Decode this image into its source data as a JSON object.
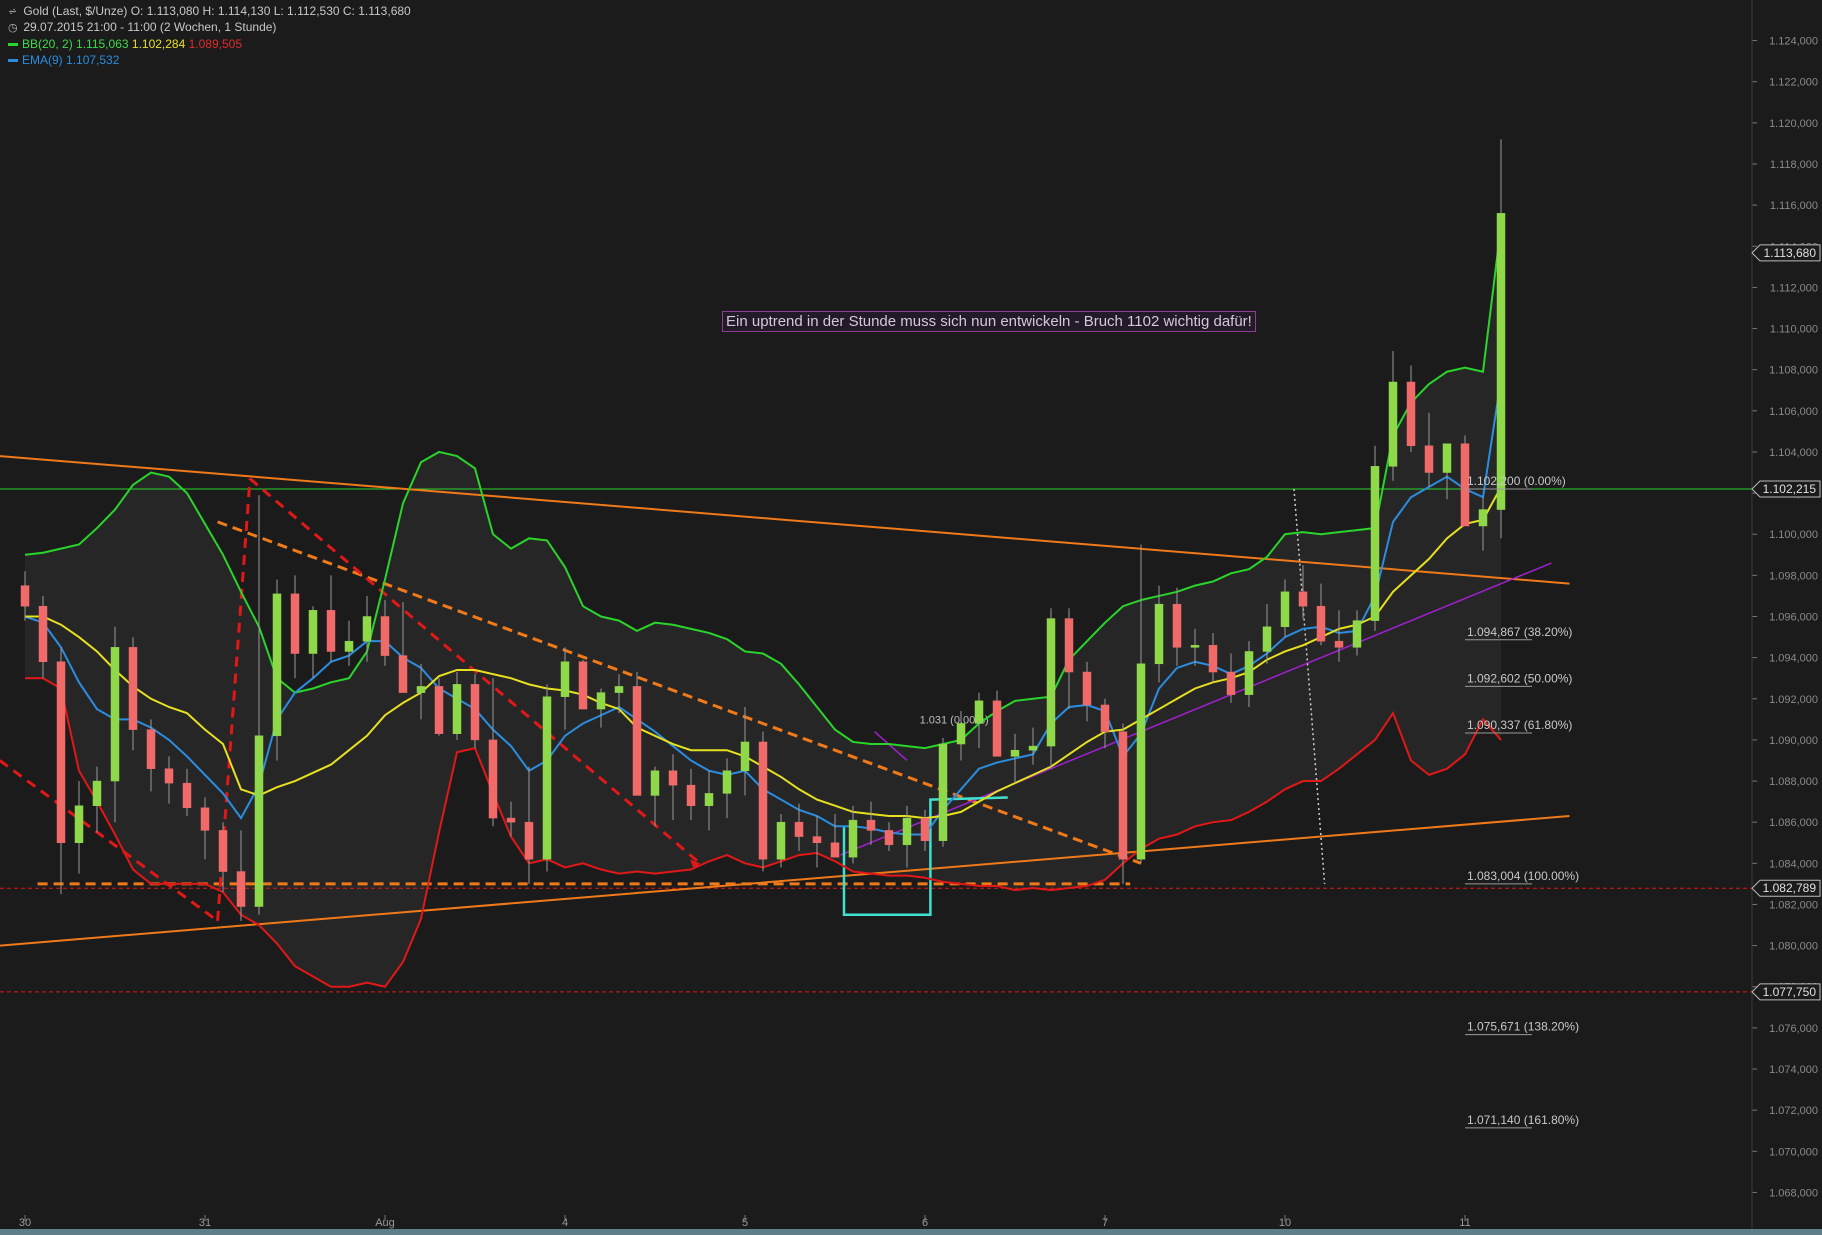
{
  "header": {
    "instrument_line": "Gold (Last, $/Unze)  O: 1.113,080  H: 1.114,130  L: 1.112,530  C: 1.113,680",
    "period_line": "29.07.2015 21:00 - 11:00 (2 Wochen, 1 Stunde)",
    "bb_label": "BB(20, 2)",
    "bb_upper": "1.115,063",
    "bb_mid": "1.102,284",
    "bb_lower": "1.089,505",
    "ema_label": "EMA(9)",
    "ema_value": "1.107,532"
  },
  "annotation": "Ein uptrend in der Stunde muss sich nun entwickeln - Bruch 1102 wichtig dafür!",
  "colors": {
    "background": "#1b1b1b",
    "bb_upper": "#2ad42a",
    "bb_lower": "#e01818",
    "bb_mid": "#e6e020",
    "ema": "#2b8de0",
    "up_candle": "#8fd84a",
    "down_candle": "#f06a6a",
    "trendline": "#f07a1a",
    "red_dashed": "#e01818",
    "cyan_shape": "#3fe0d0",
    "violet_line": "#a020d0",
    "resistance_line": "#2ad42a"
  },
  "chart_data": {
    "type": "candlestick",
    "ylim": [
      1067000,
      1125000
    ],
    "y_ticks": [
      "1.124,000",
      "1.122,000",
      "1.120,000",
      "1.118,000",
      "1.116,000",
      "1.114,000",
      "1.112,000",
      "1.110,000",
      "1.108,000",
      "1.106,000",
      "1.104,000",
      "1.102,000",
      "1.100,000",
      "1.098,000",
      "1.096,000",
      "1.094,000",
      "1.092,000",
      "1.090,000",
      "1.088,000",
      "1.086,000",
      "1.084,000",
      "1.082,000",
      "1.080,000",
      "1.078,000",
      "1.076,000",
      "1.074,000",
      "1.072,000",
      "1.070,000",
      "1.068,000"
    ],
    "y_tick_values": [
      1124000,
      1122000,
      1120000,
      1118000,
      1116000,
      1114000,
      1112000,
      1110000,
      1108000,
      1106000,
      1104000,
      1102000,
      1100000,
      1098000,
      1096000,
      1094000,
      1092000,
      1090000,
      1088000,
      1086000,
      1084000,
      1082000,
      1080000,
      1078000,
      1076000,
      1074000,
      1072000,
      1070000,
      1068000
    ],
    "x_labels": [
      "30",
      "31",
      "Aug",
      "4",
      "5",
      "6",
      "7",
      "10",
      "11"
    ],
    "x_label_bars": [
      0,
      10,
      20,
      30,
      40,
      50,
      60,
      70,
      80
    ],
    "total_bars": 83,
    "candles": [
      [
        1097500,
        1098200,
        1095800,
        1096500
      ],
      [
        1096500,
        1097000,
        1093000,
        1093800
      ],
      [
        1093800,
        1094500,
        1082500,
        1085000
      ],
      [
        1085000,
        1088000,
        1083500,
        1086800
      ],
      [
        1086800,
        1088700,
        1085500,
        1088000
      ],
      [
        1088000,
        1095500,
        1086000,
        1094500
      ],
      [
        1094500,
        1095000,
        1089500,
        1090500
      ],
      [
        1090500,
        1091000,
        1087500,
        1088600
      ],
      [
        1088600,
        1089200,
        1086900,
        1087900
      ],
      [
        1087900,
        1088600,
        1086300,
        1086700
      ],
      [
        1086700,
        1087200,
        1084200,
        1085600
      ],
      [
        1085600,
        1086000,
        1082600,
        1083600
      ],
      [
        1083600,
        1085600,
        1081200,
        1081900
      ],
      [
        1081900,
        1101900,
        1081500,
        1090200
      ],
      [
        1090200,
        1097800,
        1089000,
        1097100
      ],
      [
        1097100,
        1098000,
        1093000,
        1094200
      ],
      [
        1094200,
        1096500,
        1093000,
        1096300
      ],
      [
        1096300,
        1098000,
        1093800,
        1094300
      ],
      [
        1094300,
        1095800,
        1093600,
        1094800
      ],
      [
        1094800,
        1097000,
        1093800,
        1096000
      ],
      [
        1096000,
        1096800,
        1093600,
        1094100
      ],
      [
        1094100,
        1096700,
        1093200,
        1092300
      ],
      [
        1092300,
        1093700,
        1091000,
        1092600
      ],
      [
        1092600,
        1093000,
        1090200,
        1090300
      ],
      [
        1090300,
        1093300,
        1090000,
        1092700
      ],
      [
        1092700,
        1093200,
        1089600,
        1090000
      ],
      [
        1090000,
        1093000,
        1085800,
        1086200
      ],
      [
        1086200,
        1087000,
        1085300,
        1086000
      ],
      [
        1086000,
        1088700,
        1083000,
        1084200
      ],
      [
        1084200,
        1092700,
        1083600,
        1092100
      ],
      [
        1092100,
        1094500,
        1090500,
        1093800
      ],
      [
        1093800,
        1093900,
        1091600,
        1091500
      ],
      [
        1091500,
        1092500,
        1090600,
        1092300
      ],
      [
        1092300,
        1093200,
        1091300,
        1092600
      ],
      [
        1092600,
        1093300,
        1089600,
        1087300
      ],
      [
        1087300,
        1088700,
        1085800,
        1088500
      ],
      [
        1088500,
        1089300,
        1086100,
        1087800
      ],
      [
        1087800,
        1088600,
        1086100,
        1086800
      ],
      [
        1086800,
        1088500,
        1085600,
        1087400
      ],
      [
        1087400,
        1089100,
        1086200,
        1088500
      ],
      [
        1088500,
        1091600,
        1087300,
        1089900
      ],
      [
        1089900,
        1090400,
        1083600,
        1084200
      ],
      [
        1084200,
        1086400,
        1083800,
        1086000
      ],
      [
        1086000,
        1086900,
        1084600,
        1085300
      ],
      [
        1085300,
        1086300,
        1083800,
        1085000
      ],
      [
        1085000,
        1086400,
        1084400,
        1084300
      ],
      [
        1084300,
        1086800,
        1084000,
        1086100
      ],
      [
        1086100,
        1087000,
        1084900,
        1085600
      ],
      [
        1085600,
        1086000,
        1084600,
        1084900
      ],
      [
        1084900,
        1086800,
        1083800,
        1086200
      ],
      [
        1086200,
        1086600,
        1084600,
        1085100
      ],
      [
        1085100,
        1090100,
        1084800,
        1089800
      ],
      [
        1089800,
        1091400,
        1089000,
        1090800
      ],
      [
        1090800,
        1092300,
        1089600,
        1091900
      ],
      [
        1091900,
        1092400,
        1089800,
        1089200
      ],
      [
        1089200,
        1090300,
        1087900,
        1089500
      ],
      [
        1089500,
        1090600,
        1088800,
        1089700
      ],
      [
        1089700,
        1096400,
        1088600,
        1095900
      ],
      [
        1095900,
        1096400,
        1091500,
        1093300
      ],
      [
        1093300,
        1093800,
        1090900,
        1091700
      ],
      [
        1091700,
        1092000,
        1089600,
        1090400
      ],
      [
        1090400,
        1090800,
        1083000,
        1084200
      ],
      [
        1084200,
        1099500,
        1084000,
        1093700
      ],
      [
        1093700,
        1097500,
        1092800,
        1096600
      ],
      [
        1096600,
        1097400,
        1093600,
        1094500
      ],
      [
        1094500,
        1095400,
        1093600,
        1094600
      ],
      [
        1094600,
        1095200,
        1092800,
        1093300
      ],
      [
        1093300,
        1094200,
        1091800,
        1092200
      ],
      [
        1092200,
        1094800,
        1091600,
        1094300
      ],
      [
        1094300,
        1096600,
        1093700,
        1095500
      ],
      [
        1095500,
        1097800,
        1095000,
        1097200
      ],
      [
        1097200,
        1098500,
        1095900,
        1096500
      ],
      [
        1096500,
        1097600,
        1094600,
        1094800
      ],
      [
        1094800,
        1096300,
        1093800,
        1094500
      ],
      [
        1094500,
        1096300,
        1094100,
        1095800
      ],
      [
        1095800,
        1104300,
        1095300,
        1103300
      ],
      [
        1103300,
        1108900,
        1102600,
        1107400
      ],
      [
        1107400,
        1108200,
        1104000,
        1104300
      ],
      [
        1104300,
        1105900,
        1102300,
        1103000
      ],
      [
        1103000,
        1104300,
        1101700,
        1104400
      ],
      [
        1104400,
        1104800,
        1100500,
        1100400
      ],
      [
        1100400,
        1101800,
        1099200,
        1101200
      ],
      [
        1101200,
        1119200,
        1099800,
        1115600
      ]
    ],
    "series": [
      {
        "name": "BB(20, 2)",
        "values": [
          1099000,
          1099100,
          1099300,
          1099500,
          1100300,
          1101200,
          1102400,
          1103000,
          1102800,
          1102000,
          1100500,
          1099000,
          1097200,
          1095500,
          1093000,
          1092300,
          1092500,
          1092800,
          1093000,
          1094300,
          1097800,
          1101500,
          1103500,
          1104000,
          1103800,
          1103200,
          1100000,
          1099300,
          1099800,
          1099700,
          1098400,
          1096500,
          1096000,
          1095800,
          1095300,
          1095700,
          1095600,
          1095400,
          1095200,
          1094900,
          1094300,
          1094200,
          1093700,
          1092700,
          1091600,
          1090500,
          1089900,
          1089800,
          1089800,
          1089700,
          1089600,
          1089800,
          1090000,
          1090800,
          1091400,
          1091900,
          1092000,
          1092100,
          1093900,
          1094800,
          1095700,
          1096500,
          1096800,
          1097000,
          1097200,
          1097500,
          1097700,
          1098100,
          1098300,
          1098900,
          1100000,
          1100100,
          1100000,
          1100100,
          1100200,
          1100300,
          1104800,
          1106400,
          1107300,
          1107900,
          1108100,
          1107900,
          1115000
        ]
      },
      {
        "name": "EMA(9)",
        "values": [
          1096000,
          1095700,
          1094500,
          1092800,
          1091500,
          1091000,
          1091000,
          1090600,
          1090000,
          1089200,
          1088300,
          1087400,
          1086200,
          1087800,
          1091000,
          1092300,
          1093000,
          1093800,
          1094100,
          1094800,
          1094800,
          1094000,
          1093500,
          1092500,
          1092000,
          1091500,
          1090500,
          1089700,
          1088500,
          1089000,
          1090200,
          1090800,
          1091200,
          1091600,
          1091000,
          1090400,
          1089700,
          1089000,
          1088500,
          1088300,
          1088500,
          1087600,
          1087100,
          1086600,
          1086300,
          1085800,
          1085800,
          1085700,
          1085500,
          1085400,
          1085400,
          1086600,
          1087600,
          1088600,
          1088900,
          1089100,
          1089300,
          1090800,
          1091600,
          1091700,
          1091400,
          1089200,
          1090300,
          1092500,
          1093500,
          1093800,
          1093600,
          1093200,
          1093600,
          1094200,
          1095000,
          1095400,
          1095500,
          1095200,
          1095300,
          1097000,
          1100600,
          1101800,
          1102300,
          1102800,
          1102200,
          1101800,
          1107532
        ]
      },
      {
        "name": "bb_mid",
        "values": [
          1096000,
          1096000,
          1095600,
          1095000,
          1094300,
          1093400,
          1092600,
          1092000,
          1091600,
          1091300,
          1090500,
          1089800,
          1087600,
          1087300,
          1087700,
          1088000,
          1088400,
          1088800,
          1089500,
          1090200,
          1091200,
          1091800,
          1092300,
          1093100,
          1093400,
          1093400,
          1093200,
          1093000,
          1092700,
          1092500,
          1092400,
          1092200,
          1091800,
          1091500,
          1090600,
          1090200,
          1089800,
          1089500,
          1089500,
          1089500,
          1089200,
          1088700,
          1088200,
          1087600,
          1087100,
          1086800,
          1086500,
          1086400,
          1086300,
          1086300,
          1086200,
          1086300,
          1086500,
          1087000,
          1087500,
          1087900,
          1088300,
          1088700,
          1089300,
          1089900,
          1090400,
          1090500,
          1091000,
          1091500,
          1092000,
          1092500,
          1092800,
          1093000,
          1093300,
          1093900,
          1094300,
          1094600,
          1095000,
          1095400,
          1095600,
          1096000,
          1097200,
          1098000,
          1098800,
          1099800,
          1100500,
          1100700,
          1102284
        ]
      },
      {
        "name": "bb_lower",
        "values": [
          1093000,
          1093000,
          1092500,
          1088500,
          1087000,
          1085400,
          1083700,
          1083000,
          1083000,
          1083000,
          1083000,
          1082600,
          1081500,
          1081000,
          1080100,
          1079000,
          1078500,
          1078000,
          1078000,
          1078200,
          1078000,
          1079200,
          1081300,
          1085500,
          1089400,
          1089600,
          1087400,
          1085300,
          1084000,
          1084200,
          1083800,
          1084000,
          1083700,
          1083500,
          1083600,
          1083500,
          1083600,
          1083700,
          1084100,
          1084400,
          1084000,
          1083800,
          1084100,
          1084400,
          1084500,
          1084100,
          1083600,
          1083500,
          1083400,
          1083400,
          1083300,
          1083100,
          1083000,
          1082900,
          1082900,
          1082700,
          1082800,
          1082700,
          1082800,
          1082900,
          1083200,
          1084000,
          1084700,
          1085200,
          1085400,
          1085800,
          1086000,
          1086100,
          1086500,
          1087000,
          1087600,
          1088000,
          1088000,
          1088600,
          1089300,
          1090000,
          1091300,
          1089000,
          1088300,
          1088600,
          1089300,
          1091000,
          1090000
        ]
      }
    ],
    "horizontal_levels": [
      {
        "value": 1102200,
        "price_tag": "1.102,215",
        "style": "solid-green"
      },
      {
        "value": 1082789,
        "price_tag": "1.082,789",
        "style": "dashed-red"
      },
      {
        "value": 1077750,
        "price_tag": "1.077,750",
        "style": "dashed-red"
      }
    ],
    "last_price_tag": "1.113,680",
    "last_price_value": 1113680,
    "fib_levels": [
      {
        "label": "1.102,200 (0.00%)",
        "value": 1102200
      },
      {
        "label": "1.094,867 (38.20%)",
        "value": 1094867
      },
      {
        "label": "1.092,602 (50.00%)",
        "value": 1092602
      },
      {
        "label": "1.090,337 (61.80%)",
        "value": 1090337
      },
      {
        "label": "1.083,004 (100.00%)",
        "value": 1083004
      },
      {
        "label": "1.075,671 (138.20%)",
        "value": 1075671
      },
      {
        "label": "1.071,140 (161.80%)",
        "value": 1071140
      }
    ],
    "inline_label": "1.031 (0.00%)"
  }
}
